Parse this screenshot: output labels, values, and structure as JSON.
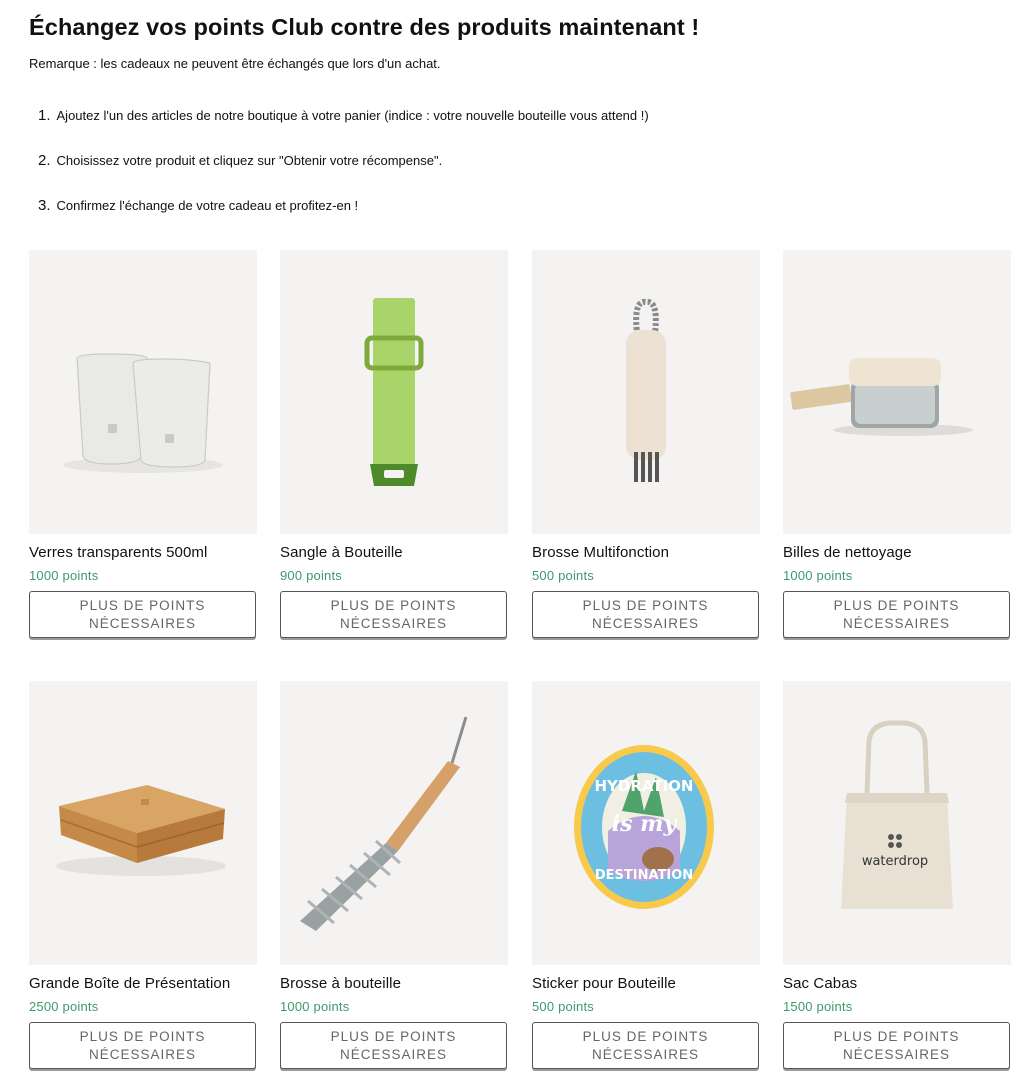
{
  "header": {
    "title": "Échangez vos points Club contre des produits maintenant !",
    "note": "Remarque : les cadeaux ne peuvent être échangés que lors d'un achat."
  },
  "steps": [
    {
      "num": "1.",
      "text": "Ajoutez l'un des articles de notre boutique à votre panier (indice : votre nouvelle bouteille vous attend !)"
    },
    {
      "num": "2.",
      "text": "Choisissez votre produit et cliquez sur \"Obtenir votre récompense\"."
    },
    {
      "num": "3.",
      "text": "Confirmez l'échange de votre cadeau et profitez-en !"
    }
  ],
  "products": [
    {
      "name": "Verres transparents 500ml",
      "points": "1000 points",
      "button": "PLUS DE POINTS NÉCESSAIRES"
    },
    {
      "name": "Sangle à Bouteille",
      "points": "900 points",
      "button": "PLUS DE POINTS NÉCESSAIRES"
    },
    {
      "name": "Brosse Multifonction",
      "points": "500 points",
      "button": "PLUS DE POINTS NÉCESSAIRES"
    },
    {
      "name": "Billes de nettoyage",
      "points": "1000 points",
      "button": "PLUS DE POINTS NÉCESSAIRES"
    },
    {
      "name": "Grande Boîte de Présentation",
      "points": "2500 points",
      "button": "PLUS DE POINTS NÉCESSAIRES"
    },
    {
      "name": "Brosse à bouteille",
      "points": "1000 points",
      "button": "PLUS DE POINTS NÉCESSAIRES"
    },
    {
      "name": "Sticker pour Bouteille",
      "points": "500 points",
      "button": "PLUS DE POINTS NÉCESSAIRES"
    },
    {
      "name": "Sac Cabas",
      "points": "1500 points",
      "button": "PLUS DE POINTS NÉCESSAIRES"
    }
  ],
  "images": {
    "sticker_text_top": "HYDRATION",
    "sticker_text_mid": "is my",
    "sticker_text_bottom": "DESTINATION",
    "tote_brand": "waterdrop"
  },
  "colors": {
    "points_green": "#3d9a6b",
    "image_bg": "#f4f3f1",
    "strap_green": "#a9d46a"
  }
}
